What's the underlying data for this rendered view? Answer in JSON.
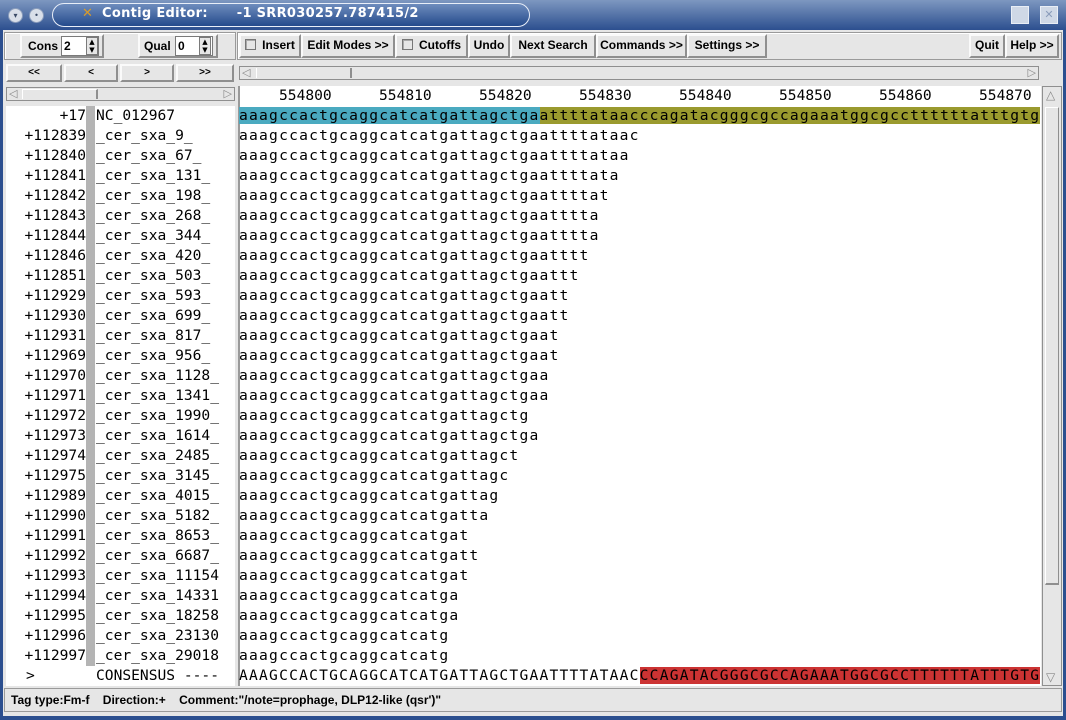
{
  "window": {
    "title": "Contig Editor:      -1 SRR030257.787415/2"
  },
  "toolbar": {
    "cons_label": "Cons",
    "cons_value": "2",
    "qual_label": "Qual",
    "qual_value": "0",
    "insert_label": "Insert",
    "edit_modes_label": "Edit Modes >>",
    "cutoffs_label": "Cutoffs",
    "undo_label": "Undo",
    "next_search_label": "Next Search",
    "commands_label": "Commands >>",
    "settings_label": "Settings >>",
    "quit_label": "Quit",
    "help_label": "Help >>"
  },
  "nav": {
    "first": "<<",
    "prev": "<",
    "next": ">",
    "last": ">>"
  },
  "ruler": [
    "554800",
    "554810",
    "554820",
    "554830",
    "554840",
    "554850",
    "554860",
    "554870"
  ],
  "reference": {
    "number": "+17",
    "name": "NC_012967",
    "tag1": "aaagccactgcaggcatcatgattagctga",
    "tag2": "attttataacccagatacgggcgccagaaatggcgccttttttatttgtg",
    "tag1_color": "#4aaac0",
    "tag2_color": "#9a9a2e"
  },
  "reads": [
    {
      "number": "+112839",
      "name": "_cer_sxa_9_",
      "seq": "aaagccactgcaggcatcatgattagctgaattttataac"
    },
    {
      "number": "+112840",
      "name": "_cer_sxa_67_",
      "seq": "aaagccactgcaggcatcatgattagctgaattttataa"
    },
    {
      "number": "+112841",
      "name": "_cer_sxa_131_",
      "seq": "aaagccactgcaggcatcatgattagctgaattttata"
    },
    {
      "number": "+112842",
      "name": "_cer_sxa_198_",
      "seq": "aaagccactgcaggcatcatgattagctgaattttat"
    },
    {
      "number": "+112843",
      "name": "_cer_sxa_268_",
      "seq": "aaagccactgcaggcatcatgattagctgaatttta"
    },
    {
      "number": "+112844",
      "name": "_cer_sxa_344_",
      "seq": "aaagccactgcaggcatcatgattagctgaatttta"
    },
    {
      "number": "+112846",
      "name": "_cer_sxa_420_",
      "seq": "aaagccactgcaggcatcatgattagctgaatttt"
    },
    {
      "number": "+112851",
      "name": "_cer_sxa_503_",
      "seq": "aaagccactgcaggcatcatgattagctgaattt"
    },
    {
      "number": "+112929",
      "name": "_cer_sxa_593_",
      "seq": "aaagccactgcaggcatcatgattagctgaatt"
    },
    {
      "number": "+112930",
      "name": "_cer_sxa_699_",
      "seq": "aaagccactgcaggcatcatgattagctgaatt"
    },
    {
      "number": "+112931",
      "name": "_cer_sxa_817_",
      "seq": "aaagccactgcaggcatcatgattagctgaat"
    },
    {
      "number": "+112969",
      "name": "_cer_sxa_956_",
      "seq": "aaagccactgcaggcatcatgattagctgaat"
    },
    {
      "number": "+112970",
      "name": "_cer_sxa_1128_",
      "seq": "aaagccactgcaggcatcatgattagctgaa"
    },
    {
      "number": "+112971",
      "name": "_cer_sxa_1341_",
      "seq": "aaagccactgcaggcatcatgattagctgaa"
    },
    {
      "number": "+112972",
      "name": "_cer_sxa_1990_",
      "seq": "aaagccactgcaggcatcatgattagctg"
    },
    {
      "number": "+112973",
      "name": "_cer_sxa_1614_",
      "seq": "aaagccactgcaggcatcatgattagctga"
    },
    {
      "number": "+112974",
      "name": "_cer_sxa_2485_",
      "seq": "aaagccactgcaggcatcatgattagct"
    },
    {
      "number": "+112975",
      "name": "_cer_sxa_3145_",
      "seq": "aaagccactgcaggcatcatgattagc"
    },
    {
      "number": "+112989",
      "name": "_cer_sxa_4015_",
      "seq": "aaagccactgcaggcatcatgattag"
    },
    {
      "number": "+112990",
      "name": "_cer_sxa_5182_",
      "seq": "aaagccactgcaggcatcatgatta"
    },
    {
      "number": "+112991",
      "name": "_cer_sxa_8653_",
      "seq": "aaagccactgcaggcatcatgat"
    },
    {
      "number": "+112992",
      "name": "_cer_sxa_6687_",
      "seq": "aaagccactgcaggcatcatgatt"
    },
    {
      "number": "+112993",
      "name": "_cer_sxa_11154",
      "seq": "aaagccactgcaggcatcatgat"
    },
    {
      "number": "+112994",
      "name": "_cer_sxa_14331",
      "seq": "aaagccactgcaggcatcatga"
    },
    {
      "number": "+112995",
      "name": "_cer_sxa_18258",
      "seq": "aaagccactgcaggcatcatga"
    },
    {
      "number": "+112996",
      "name": "_cer_sxa_23130",
      "seq": "aaagccactgcaggcatcatg"
    },
    {
      "number": "+112997",
      "name": "_cer_sxa_29018",
      "seq": "aaagccactgcaggcatcatg"
    }
  ],
  "consensus": {
    "marker": ">",
    "name": "CONSENSUS ----",
    "plain": "AAAGCCACTGCAGGCATCATGATTAGCTGAATTTTATAAC",
    "highlighted": "CCAGATACGGGCGCCAGAAATGGCGCCTTTTTTATTTGTG",
    "highlight_color": "#cc3333"
  },
  "status": {
    "text": "Tag type:Fm-f    Direction:+    Comment:\"/note=prophage, DLP12-like (qsr')\""
  },
  "icons": {
    "shade": "▾",
    "stick": "•",
    "app": "✕",
    "scroll_left": "◁",
    "scroll_right": "▷",
    "scroll_up": "△",
    "scroll_down": "▽",
    "spin": "▲▼"
  }
}
